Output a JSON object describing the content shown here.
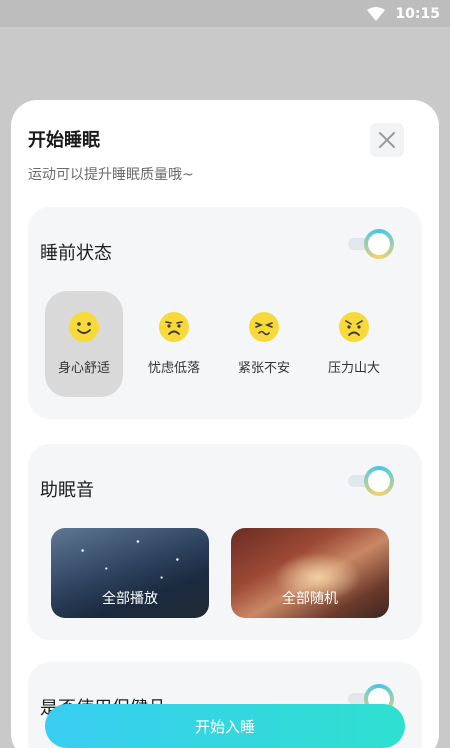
{
  "status_bar": {
    "time": "10:15",
    "wifi_icon": "wifi-icon"
  },
  "sheet": {
    "title": "开始睡眠",
    "subtitle": "运动可以提升睡眠质量哦~",
    "close_icon": "close-icon"
  },
  "pre_sleep": {
    "title": "睡前状态",
    "toggle_on": true,
    "moods": [
      {
        "label": "身心舒适",
        "icon": "smile-face-icon",
        "selected": true
      },
      {
        "label": "忧虑低落",
        "icon": "sad-face-icon",
        "selected": false
      },
      {
        "label": "紧张不安",
        "icon": "nervous-face-icon",
        "selected": false
      },
      {
        "label": "压力山大",
        "icon": "stressed-face-icon",
        "selected": false
      }
    ]
  },
  "sleep_sound": {
    "title": "助眠音",
    "toggle_on": true,
    "tiles": [
      {
        "label": "全部播放"
      },
      {
        "label": "全部随机"
      }
    ]
  },
  "third_section": {
    "title": "是否使用保健品",
    "toggle_on": true
  },
  "start_button": {
    "label": "开始入睡"
  },
  "colors": {
    "accent_start": "#39cdf2",
    "accent_end": "#2fe0cf",
    "emoji_yellow": "#f7d93a"
  }
}
